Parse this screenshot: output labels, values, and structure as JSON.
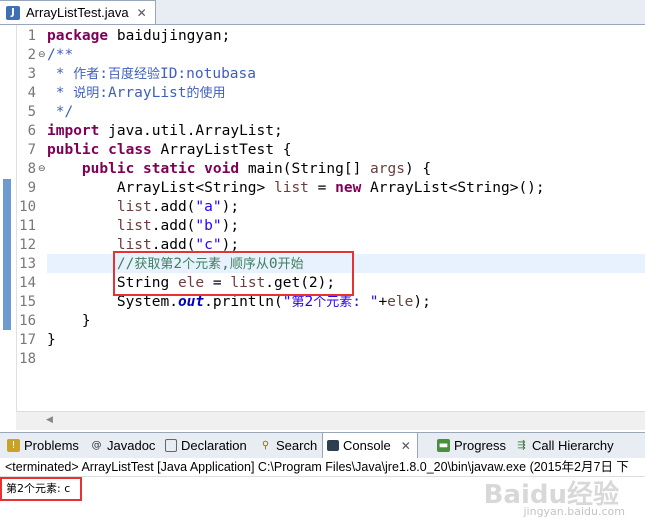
{
  "editor": {
    "tab_label": "ArrayListTest.java",
    "tab_icon": "J",
    "close_glyph": "✕",
    "lines": [
      {
        "n": "1",
        "t": "package baidujingyan;"
      },
      {
        "n": "2",
        "t": "/**"
      },
      {
        "n": "3",
        "t": " * 作者:百度经验ID:notubasa"
      },
      {
        "n": "4",
        "t": " * 说明:ArrayList的使用"
      },
      {
        "n": "5",
        "t": " */"
      },
      {
        "n": "6",
        "t": "import java.util.ArrayList;"
      },
      {
        "n": "7",
        "t": "public class ArrayListTest {"
      },
      {
        "n": "8",
        "t": "    public static void main(String[] args) {"
      },
      {
        "n": "9",
        "t": "        ArrayList<String> list = new ArrayList<String>();"
      },
      {
        "n": "10",
        "t": "        list.add(\"a\");"
      },
      {
        "n": "11",
        "t": "        list.add(\"b\");"
      },
      {
        "n": "12",
        "t": "        list.add(\"c\");"
      },
      {
        "n": "13",
        "t": "        //获取第2个元素,顺序从0开始"
      },
      {
        "n": "14",
        "t": "        String ele = list.get(2);"
      },
      {
        "n": "15",
        "t": "        System.out.println(\"第2个元素: \"+ele);"
      },
      {
        "n": "16",
        "t": "    }"
      },
      {
        "n": "17",
        "t": "}"
      },
      {
        "n": "18",
        "t": ""
      }
    ],
    "current_line": "13"
  },
  "views": {
    "tabs": [
      {
        "label": "Problems",
        "icon": "problems-icon"
      },
      {
        "label": "Javadoc",
        "icon": "javadoc-icon"
      },
      {
        "label": "Declaration",
        "icon": "declaration-icon"
      },
      {
        "label": "Search",
        "icon": "search-icon"
      },
      {
        "label": "Console",
        "icon": "console-icon"
      },
      {
        "label": "Progress",
        "icon": "progress-icon"
      },
      {
        "label": "Call Hierarchy",
        "icon": "call-hierarchy-icon"
      }
    ],
    "console_close": "✕"
  },
  "console": {
    "header": "<terminated> ArrayListTest [Java Application] C:\\Program Files\\Java\\jre1.8.0_20\\bin\\javaw.exe (2015年2月7日 下",
    "output": "第2个元素: c"
  },
  "watermark": {
    "logo": "Baidu经验",
    "url": "jingyan.baidu.com"
  },
  "colors": {
    "keyword": "#7f0055",
    "javadoc": "#3f5fbf",
    "comment": "#3f7f5f",
    "string": "#2a00ff",
    "field": "#0000c0",
    "highlight_box": "#e63232",
    "current_line_bg": "#e8f2fe"
  }
}
